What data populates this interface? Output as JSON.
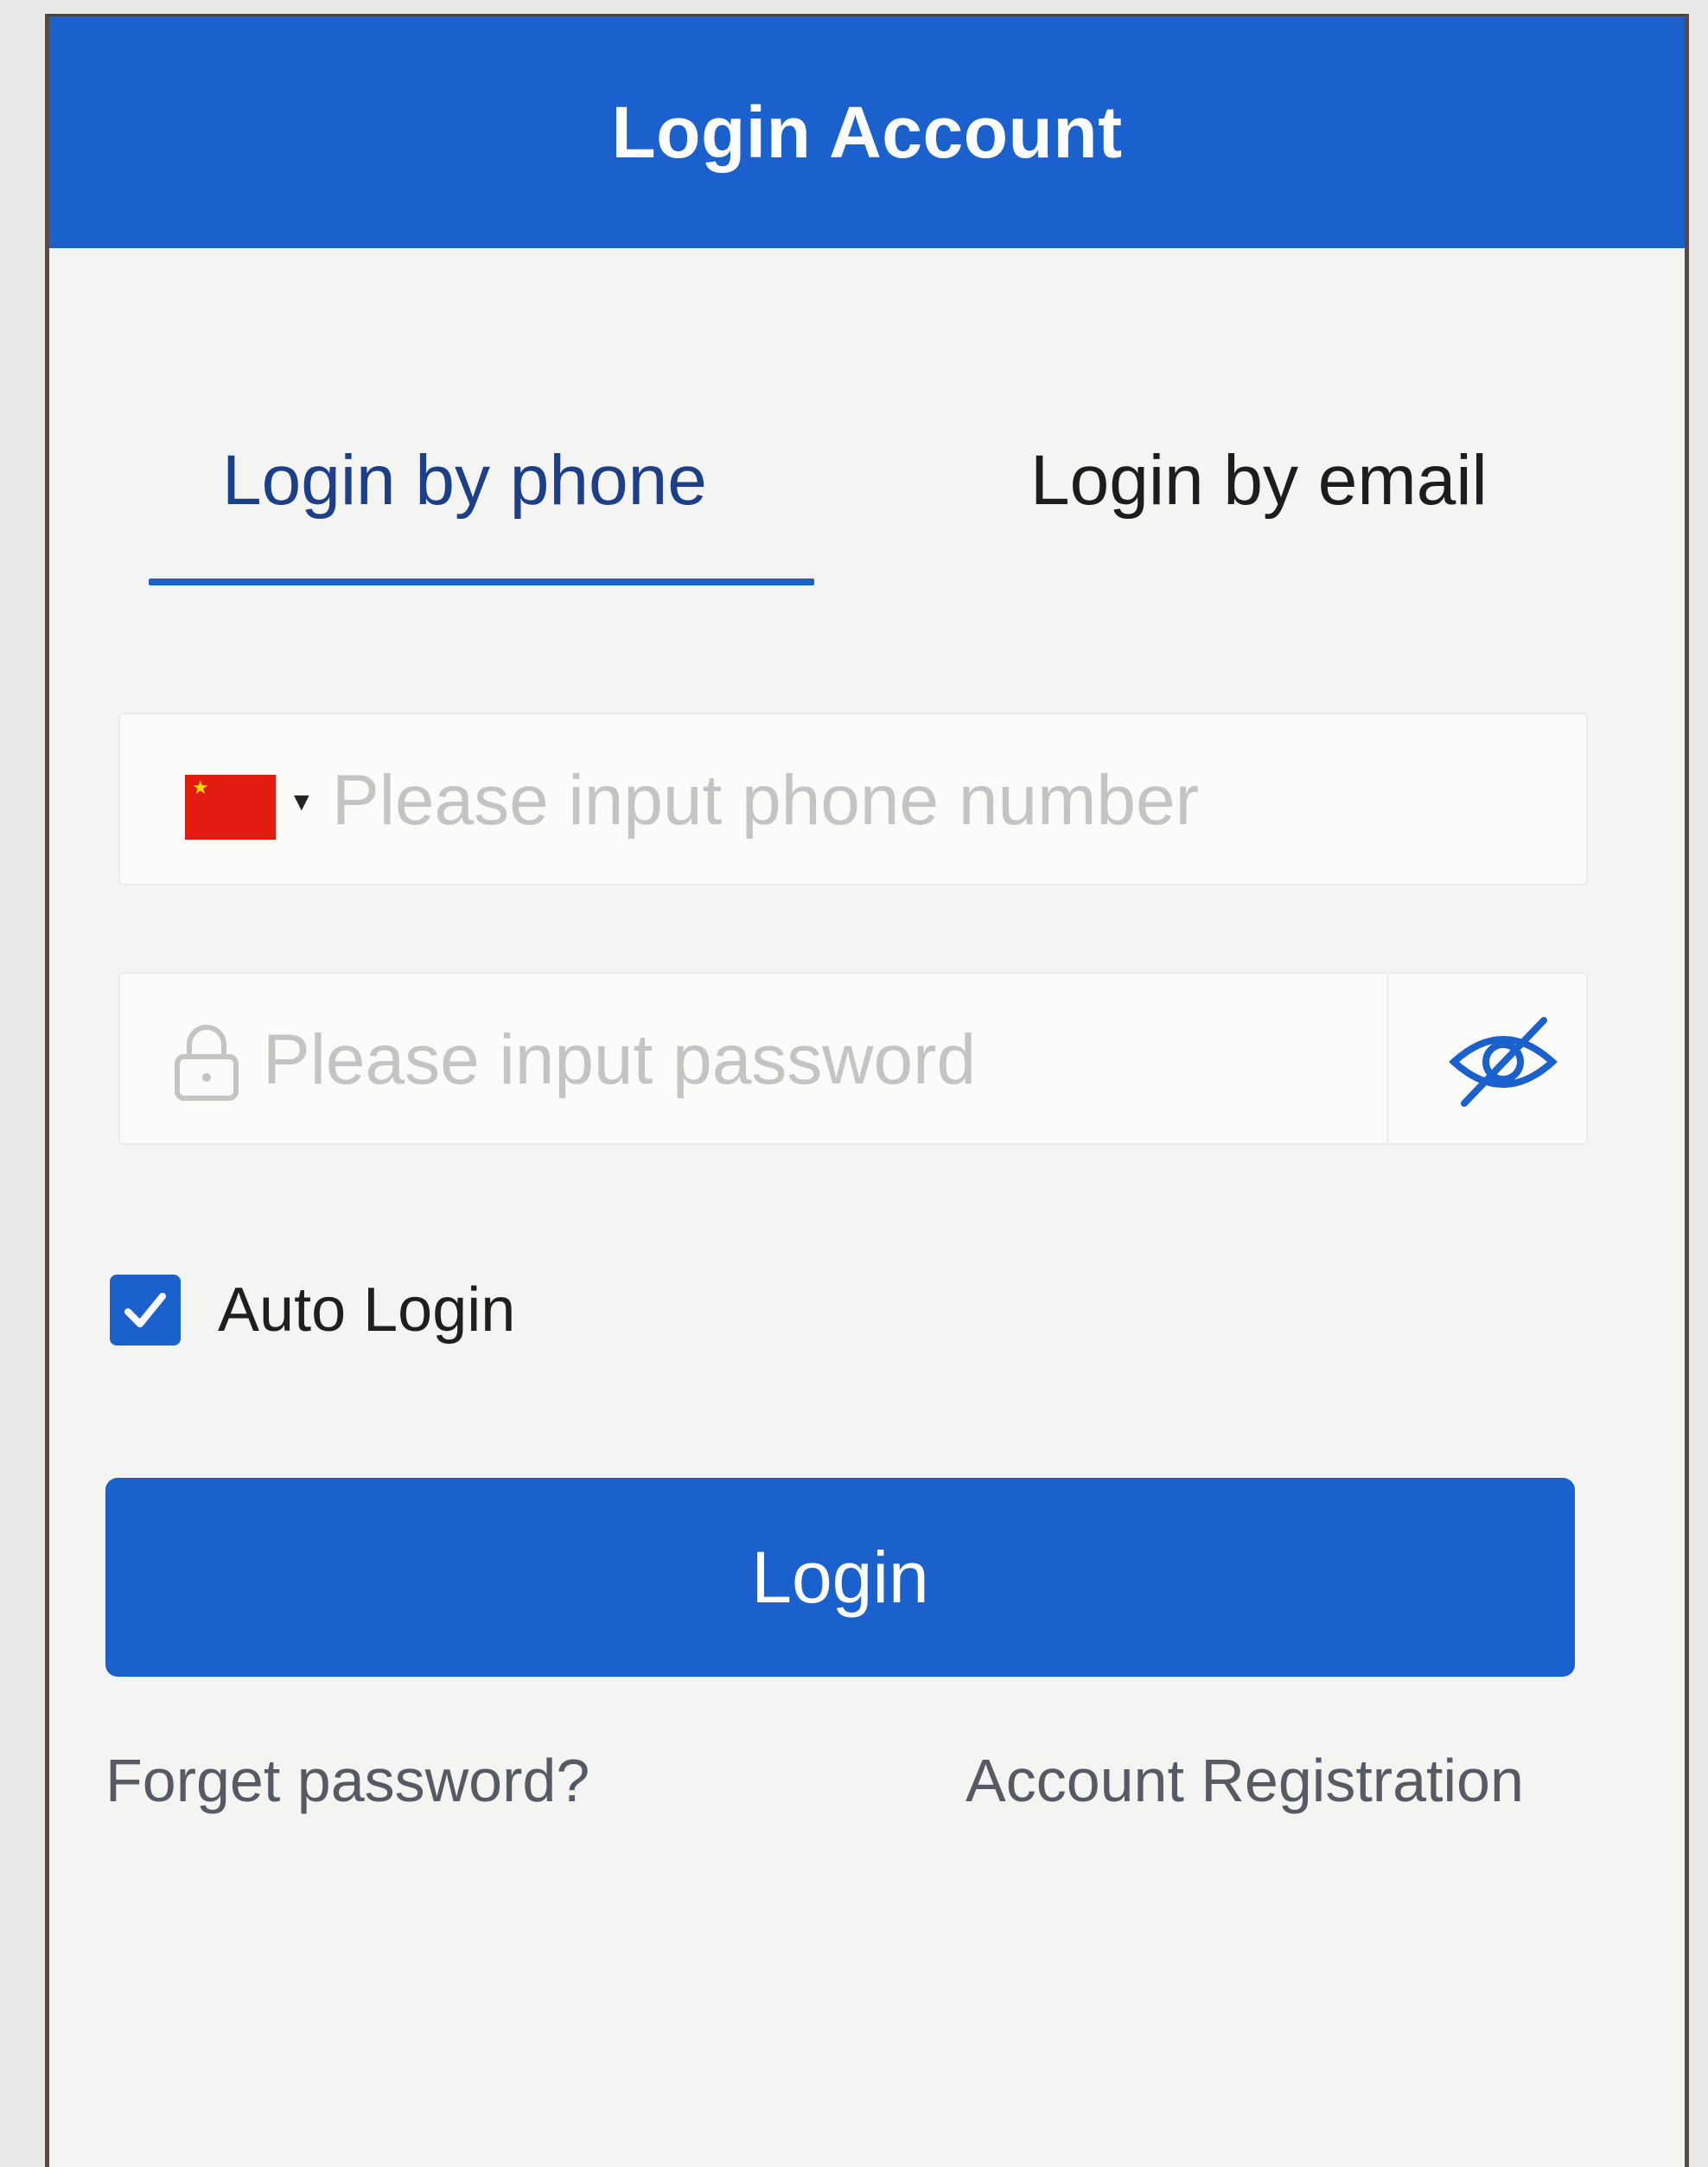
{
  "header": {
    "title": "Login Account"
  },
  "tabs": [
    {
      "label": "Login by phone",
      "active": true
    },
    {
      "label": "Login by email",
      "active": false
    }
  ],
  "phone_field": {
    "country_flag_icon": "china-flag-icon",
    "placeholder": "Please input phone number",
    "value": ""
  },
  "password_field": {
    "icon": "lock-icon",
    "placeholder": "Please input password",
    "value": "",
    "toggle_icon": "eye-off-icon"
  },
  "auto_login": {
    "label": "Auto Login",
    "checked": true
  },
  "login_button": {
    "label": "Login"
  },
  "links": {
    "forgot": "Forget password?",
    "register": "Account Registration"
  },
  "colors": {
    "primary": "#1b61cd",
    "active_tab_text": "#1c3f87",
    "placeholder": "#c4c4c4",
    "link": "#555a63"
  }
}
